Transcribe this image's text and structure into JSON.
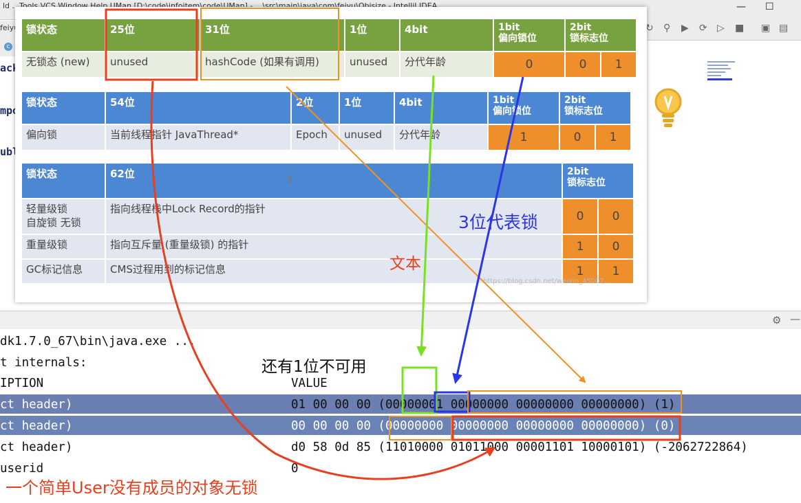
{
  "ide": {
    "title_text": "ld  ...Tools  VCS  Window  Help  UMan [D:\\code\\infoitem\\code\\UMan] - ...\\src\\main\\java\\com\\feiyu\\Objsize - IntelliJ IDEA",
    "tab_fragment": "feiyu",
    "side_text_1": "ack",
    "side_text_2": "mpo",
    "side_text_3": "ubl"
  },
  "tables": {
    "lock_free": {
      "headers": [
        "锁状态",
        "25位",
        "31位",
        "1位",
        "4bit",
        "1bit\n偏向锁位",
        "2bit\n锁标志位"
      ],
      "row": [
        "无锁态 (new)",
        "unused",
        "hashCode (如果有调用)",
        "unused",
        "分代年龄",
        "0",
        "0",
        "1"
      ]
    },
    "biased": {
      "headers": [
        "锁状态",
        "54位",
        "2位",
        "1位",
        "4bit",
        "1bit\n偏向锁位",
        "2bit\n锁标志位"
      ],
      "row": [
        "偏向锁",
        "当前线程指针 JavaThread*",
        "Epoch",
        "unused",
        "分代年龄",
        "1",
        "0",
        "1"
      ]
    },
    "others": {
      "headers": [
        "锁状态",
        "62位",
        "2bit\n锁标志位"
      ],
      "rows": [
        {
          "state": "轻量级锁\n自旋锁 无锁",
          "desc": "指向线程栈中Lock Record的指针",
          "b1": "0",
          "b2": "0"
        },
        {
          "state": "重量级锁",
          "desc": "指向互斥量 (重量级锁) 的指针",
          "b1": "1",
          "b2": "0"
        },
        {
          "state": "GC标记信息",
          "desc": "CMS过程用到的标记信息",
          "b1": "1",
          "b2": "1"
        }
      ]
    }
  },
  "watermark": "https://blog.csdn.net/weixin_45007...",
  "console": {
    "lines": [
      {
        "label": "dk1.7.0_67\\bin\\java.exe ...",
        "value": ""
      },
      {
        "label": "t internals:",
        "value": ""
      },
      {
        "label": "IPTION",
        "value": "VALUE"
      },
      {
        "label": "ct header)",
        "value": "01 00 00 00 (00000001 00000000 00000000 00000000) (1)"
      },
      {
        "label": "ct header)",
        "value": "00 00 00 00 (00000000 00000000 00000000 00000000) (0)"
      },
      {
        "label": "ct header)",
        "value": "d0 58 0d 85 (11010000 01011000 00001101 10000101) (-2062722864)"
      },
      {
        "label": "userid",
        "value": "0"
      }
    ]
  },
  "annotations": {
    "three_bits": "3位代表锁",
    "text_label": "文本",
    "one_bit_unusable": "还有1位不可用",
    "empty_user": "一个简单User没有成员的对象无锁"
  },
  "colors": {
    "green_header": "#78a240",
    "blue_header": "#4b87d2",
    "orange_cell": "#ee8f2b",
    "arrow_red": "#e8401f",
    "arrow_orange": "#f0921e",
    "arrow_green": "#7ae025",
    "arrow_blue": "#2b35e8",
    "selection": "#6c7fb2"
  }
}
